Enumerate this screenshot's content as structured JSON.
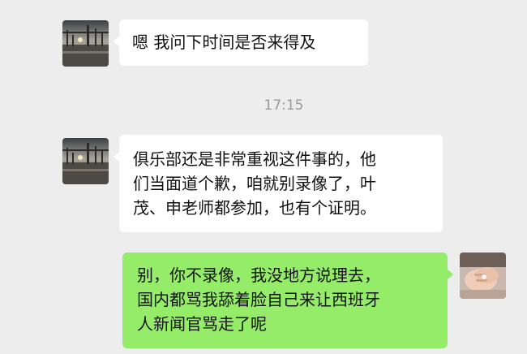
{
  "chat": {
    "timestamp": "17:15",
    "messages": [
      {
        "sender": "incoming",
        "lines": [
          "嗯 我问下时间是否来得及"
        ]
      },
      {
        "sender": "incoming",
        "lines": [
          "俱乐部还是非常重视这件事的，他",
          "们当面道个歉，咱就别录像了，叶",
          "茂、申老师都参加，也有个证明。"
        ]
      },
      {
        "sender": "outgoing",
        "lines": [
          "别，你不录像，我没地方说理去，",
          "国内都骂我舔着脸自己来让西班牙",
          "人新闻官骂走了呢"
        ]
      }
    ]
  },
  "colors": {
    "background": "#ededed",
    "incoming_bubble": "#ffffff",
    "outgoing_bubble": "#95ec69",
    "timestamp_text": "#9a9a9a"
  }
}
